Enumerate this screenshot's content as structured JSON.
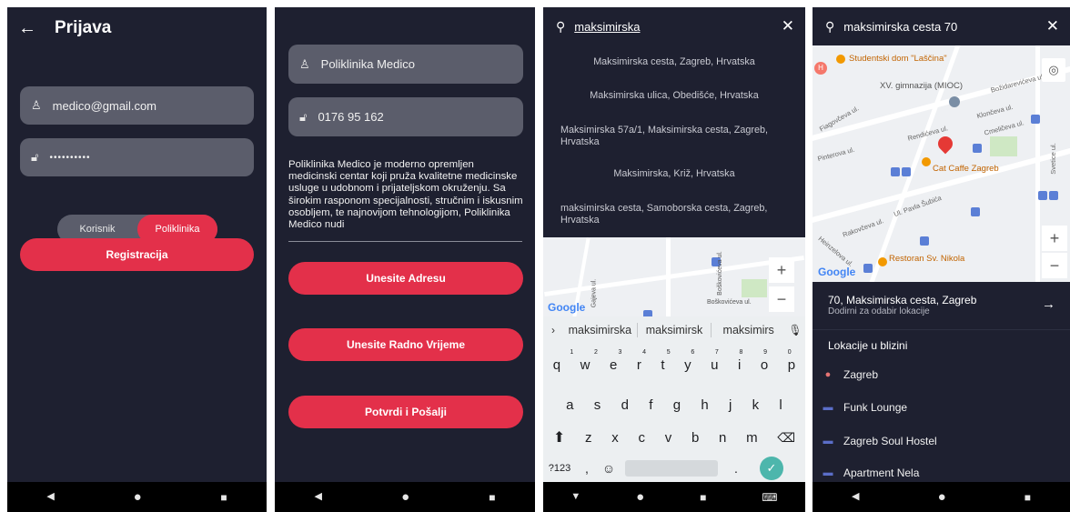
{
  "screen1": {
    "title": "Prijava",
    "email": "medico@gmail.com",
    "password": "••••••••••",
    "toggle_left": "Korisnik",
    "toggle_right": "Poliklinika",
    "register_button": "Registracija"
  },
  "screen2": {
    "name_field": "Poliklinika Medico",
    "phone_field": "0176 95 162",
    "description": "Poliklinika Medico je moderno opremljen medicinski centar koji pruža kvalitetne medicinske usluge u udobnom i prijateljskom okruženju. Sa širokim rasponom specijalnosti, stručnim i iskusnim osobljem, te najnovijom tehnologijom, Poliklinika Medico nudi",
    "address_button": "Unesite Adresu",
    "hours_button": "Unesite Radno Vrijeme",
    "submit_button": "Potvrdi i Pošalji"
  },
  "screen3": {
    "query": "maksimirska",
    "suggestions": [
      "Maksimirska cesta, Zagreb, Hrvatska",
      "Maksimirska ulica, Obedišće, Hrvatska",
      "Maksimirska 57a/1, Maksimirska cesta, Zagreb, Hrvatska",
      "Maksimirska, Križ, Hrvatska",
      "maksimirska cesta, Samoborska cesta, Zagreb, Hrvatska"
    ],
    "map_labels": {
      "google": "Google",
      "street1": "Boškovićeva ul.",
      "street2": "Gajeva ul."
    },
    "predictions": [
      "maksimirska",
      "maksimirsk",
      "maksimirs"
    ],
    "keyboard": {
      "row1": [
        "q",
        "w",
        "e",
        "r",
        "t",
        "y",
        "u",
        "i",
        "o",
        "p"
      ],
      "row1_hints": [
        "1",
        "2",
        "3",
        "4",
        "5",
        "6",
        "7",
        "8",
        "9",
        "0"
      ],
      "row2": [
        "a",
        "s",
        "d",
        "f",
        "g",
        "h",
        "j",
        "k",
        "l"
      ],
      "row3": [
        "z",
        "x",
        "c",
        "v",
        "b",
        "n",
        "m"
      ],
      "symbols_key": "?123",
      "comma_key": ",",
      "period_key": "."
    }
  },
  "screen4": {
    "query": "maksimirska cesta 70",
    "map_labels": {
      "dorm": "Studentski dom \"Laščina\"",
      "school": "XV. gimnazija (MIOC)",
      "cafe": "Cat Caffe Zagreb",
      "restaurant": "Restoran Sv. Nikola",
      "street_pavla": "Ul. Pavla Šubića",
      "street_rakovceva": "Rakovčeva ul.",
      "street_pinterova": "Pinterova ul.",
      "street_fiagovceva": "Fiagovčeva ul.",
      "street_bozidarevic": "Božidarevićeva ul.",
      "street_klonceva": "Klončeva ul.",
      "street_cmeliceva": "Cmeličeva ul.",
      "street_rendiceva": "Rendićeva ul.",
      "street_svetice": "Svetice ul.",
      "street_heinzelova": "Heinzelova ul.",
      "google": "Google"
    },
    "selected_title": "70, Maksimirska cesta, Zagreb",
    "selected_subtitle": "Dodirni za odabir lokacije",
    "nearby_header": "Lokacije u blizini",
    "nearby": [
      "Zagreb",
      "Funk Lounge",
      "Zagreb Soul Hostel",
      "Apartment Nela"
    ]
  },
  "colors": {
    "background": "#1e2030",
    "accent": "#e3304a",
    "field": "#5b5d6b"
  }
}
